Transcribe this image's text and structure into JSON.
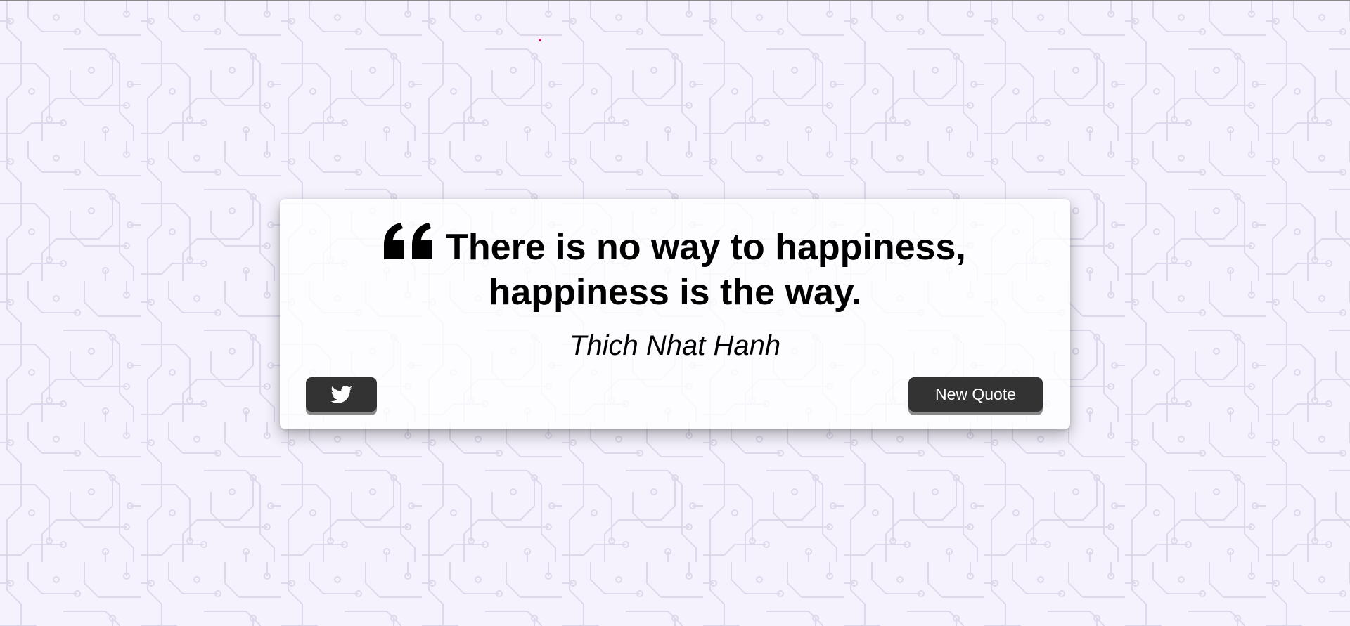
{
  "quote": {
    "text": "There is no way to happiness, happiness is the way.",
    "author": "Thich Nhat Hanh",
    "icon": "quote-left-icon"
  },
  "actions": {
    "tweet_icon": "twitter-icon",
    "new_quote_label": "New Quote"
  },
  "colors": {
    "background": "#f5f2fd",
    "circuit_pattern": "#ddd9ec",
    "button": "#333333",
    "button_shadow": "#888888",
    "text": "#000000",
    "button_text": "#ffffff"
  }
}
